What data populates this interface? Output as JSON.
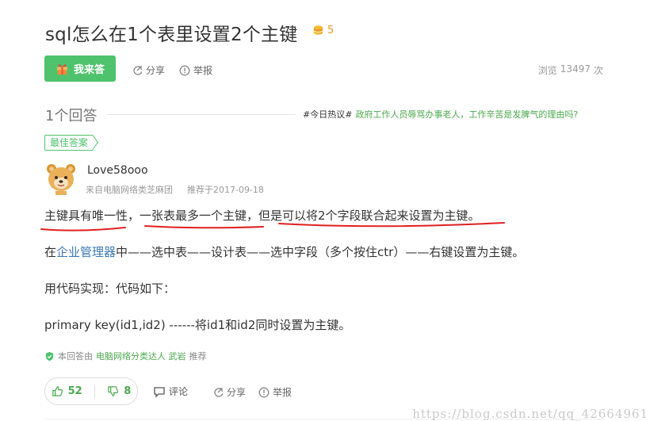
{
  "question": {
    "title": "sql怎么在1个表里设置2个主键",
    "reward": "5"
  },
  "toolbar": {
    "answer_label": "我来答",
    "share_label": "分享",
    "report_label": "举报",
    "views_label": "浏览",
    "views_count": "13497",
    "views_unit": "次"
  },
  "answers_header": {
    "count_label": "1个回答",
    "hot_tag": "#今日热议#",
    "hot_text": "政府工作人员辱骂办事老人，工作辛苦是发脾气的理由吗?"
  },
  "answer": {
    "best_label": "最佳答案",
    "username": "Love58ooo",
    "source": "来自电脑网络类芝麻团",
    "date": "推荐于2017-09-18",
    "p1": "主键具有唯一性，一张表最多一个主键，但是可以将2个字段联合起来设置为主键。",
    "p2_before": "在",
    "p2_link": "企业管理器",
    "p2_after": "中——选中表——设计表——选中字段（多个按住ctr）——右键设置为主键。",
    "p3": "用代码实现：代码如下：",
    "p4": "primary key(id1,id2) ------将id1和id2同时设置为主键。",
    "rec_prefix": "本回答由",
    "rec_link": "电脑网络分类达人 武岩",
    "rec_suffix": "推荐",
    "upvotes": "52",
    "downvotes": "8",
    "comment_label": "评论",
    "share_label": "分享",
    "report_label": "举报"
  },
  "watermark": "https://blog.csdn.net/qq_42664961",
  "colors": {
    "accent_green": "#4ec26c",
    "link_blue": "#3b79b6",
    "annotation_red": "#e0201e",
    "coin_gold": "#e89a1d"
  }
}
